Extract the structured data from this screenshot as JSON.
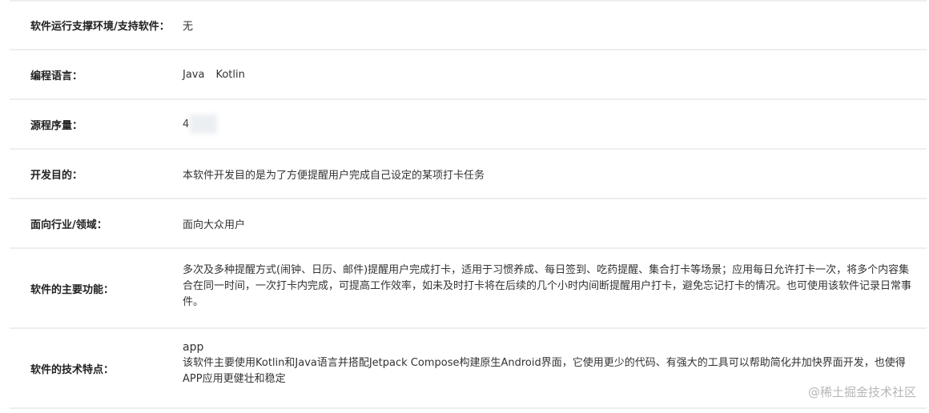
{
  "rows": [
    {
      "label": "软件运行支撑环境/支持软件：",
      "value": "无"
    },
    {
      "label": "编程语言：",
      "languages": [
        "Java",
        "Kotlin"
      ]
    },
    {
      "label": "源程序量：",
      "value": "4"
    },
    {
      "label": "开发目的：",
      "value": "本软件开发目的是为了方便提醒用户完成自己设定的某项打卡任务"
    },
    {
      "label": "面向行业/领域：",
      "value": "面向大众用户"
    },
    {
      "label": "软件的主要功能：",
      "value": "多次及多种提醒方式(闹钟、日历、邮件)提醒用户完成打卡，适用于习惯养成、每日签到、吃药提醒、集合打卡等场景；应用每日允许打卡一次，将多个内容集合在同一时间，一次打卡内完成，可提高工作效率，如未及时打卡将在后续的几个小时内间断提醒用户打卡，避免忘记打卡的情况。也可使用该软件记录日常事件。"
    },
    {
      "label": "软件的技术特点：",
      "value_title": "app",
      "value": "该软件主要使用Kotlin和Java语言并搭配Jetpack Compose构建原生Android界面，它使用更少的代码、有强大的工具可以帮助简化并加快界面开发，也使得APP应用更健壮和稳定"
    }
  ],
  "watermark": "@稀土掘金技术社区"
}
